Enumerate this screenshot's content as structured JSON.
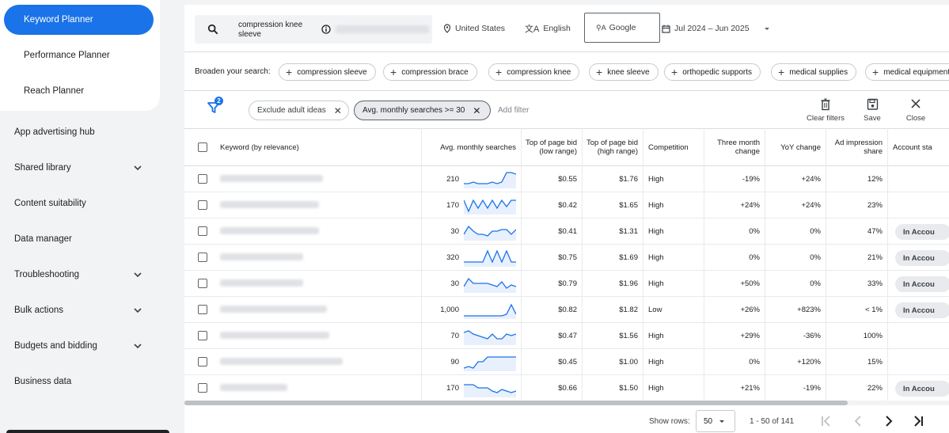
{
  "sidebar": {
    "planners": [
      {
        "label": "Keyword Planner",
        "active": true
      },
      {
        "label": "Performance Planner",
        "active": false
      },
      {
        "label": "Reach Planner",
        "active": false
      }
    ],
    "nav": [
      {
        "label": "App advertising hub",
        "expandable": false
      },
      {
        "label": "Shared library",
        "expandable": true
      },
      {
        "label": "Content suitability",
        "expandable": false
      },
      {
        "label": "Data manager",
        "expandable": false
      },
      {
        "label": "Troubleshooting",
        "expandable": true
      },
      {
        "label": "Bulk actions",
        "expandable": true
      },
      {
        "label": "Budgets and bidding",
        "expandable": true
      },
      {
        "label": "Business data",
        "expandable": false
      }
    ]
  },
  "search": {
    "query": "compression knee sleeve",
    "location": "United States",
    "language": "English",
    "network": "Google",
    "date_range": "Jul 2024 – Jun 2025"
  },
  "broaden": {
    "label": "Broaden your search:",
    "chips": [
      "compression sleeve",
      "compression brace",
      "compression knee",
      "knee sleeve",
      "orthopedic supports",
      "medical supplies",
      "medical equipment"
    ]
  },
  "filters": {
    "count": "2",
    "chips": [
      {
        "label": "Exclude adult ideas",
        "selected": false
      },
      {
        "label": "Avg. monthly searches >= 30",
        "selected": true
      }
    ],
    "add_filter": "Add filter",
    "tools": {
      "clear": "Clear filters",
      "save": "Save",
      "close": "Close"
    }
  },
  "table": {
    "headers": {
      "keyword": "Keyword (by relevance)",
      "avg": "Avg. monthly searches",
      "low": "Top of page bid (low range)",
      "high": "Top of page bid (high range)",
      "competition": "Competition",
      "three_month": "Three month change",
      "yoy": "YoY change",
      "impression": "Ad impression share",
      "account": "Account sta"
    },
    "rows": [
      {
        "avg": "210",
        "low": "$0.55",
        "high": "$1.76",
        "competition": "High",
        "three_month": "-19%",
        "yoy": "+24%",
        "impression": "12%",
        "account": "",
        "trend": [
          2,
          2,
          3,
          2,
          2,
          2,
          3,
          2,
          3,
          9,
          9,
          8
        ]
      },
      {
        "avg": "170",
        "low": "$0.42",
        "high": "$1.65",
        "competition": "High",
        "three_month": "+24%",
        "yoy": "+24%",
        "impression": "23%",
        "account": "",
        "trend": [
          8,
          1,
          8,
          3,
          8,
          3,
          8,
          3,
          8,
          4,
          8,
          8
        ]
      },
      {
        "avg": "30",
        "low": "$0.41",
        "high": "$1.31",
        "competition": "High",
        "three_month": "0%",
        "yoy": "0%",
        "impression": "47%",
        "account": "In Accou",
        "trend": [
          3,
          8,
          5,
          3,
          3,
          2,
          5,
          5,
          6,
          6,
          3,
          6
        ]
      },
      {
        "avg": "320",
        "low": "$0.75",
        "high": "$1.69",
        "competition": "High",
        "three_month": "0%",
        "yoy": "0%",
        "impression": "21%",
        "account": "In Accou",
        "trend": [
          2,
          2,
          2,
          2,
          2,
          9,
          2,
          9,
          2,
          9,
          2,
          2
        ]
      },
      {
        "avg": "30",
        "low": "$0.79",
        "high": "$1.96",
        "competition": "High",
        "three_month": "+50%",
        "yoy": "0%",
        "impression": "33%",
        "account": "In Accou",
        "trend": [
          3,
          8,
          5,
          5,
          5,
          5,
          4,
          3,
          6,
          2,
          4,
          3
        ]
      },
      {
        "avg": "1,000",
        "low": "$0.82",
        "high": "$1.82",
        "competition": "Low",
        "three_month": "+26%",
        "yoy": "+823%",
        "impression": "< 1%",
        "account": "In Accou",
        "trend": [
          1,
          1,
          1,
          1,
          1,
          1,
          1,
          1,
          1,
          2,
          8,
          2
        ]
      },
      {
        "avg": "70",
        "low": "$0.47",
        "high": "$1.56",
        "competition": "High",
        "three_month": "+29%",
        "yoy": "-36%",
        "impression": "100%",
        "account": "",
        "trend": [
          7,
          8,
          6,
          5,
          4,
          3,
          6,
          3,
          3,
          6,
          5,
          6
        ]
      },
      {
        "avg": "90",
        "low": "$0.45",
        "high": "$1.00",
        "competition": "High",
        "three_month": "0%",
        "yoy": "+120%",
        "impression": "15%",
        "account": "",
        "trend": [
          1,
          2,
          1,
          5,
          5,
          8,
          8,
          8,
          8,
          8,
          8,
          8
        ]
      },
      {
        "avg": "170",
        "low": "$0.66",
        "high": "$1.50",
        "competition": "High",
        "three_month": "+21%",
        "yoy": "-19%",
        "impression": "22%",
        "account": "In Accou",
        "trend": [
          7,
          7,
          7,
          5,
          5,
          5,
          3,
          2,
          4,
          3,
          2,
          3
        ]
      }
    ]
  },
  "pagination": {
    "show_rows_label": "Show rows:",
    "rows_value": "50",
    "range": "1 - 50 of 141"
  }
}
